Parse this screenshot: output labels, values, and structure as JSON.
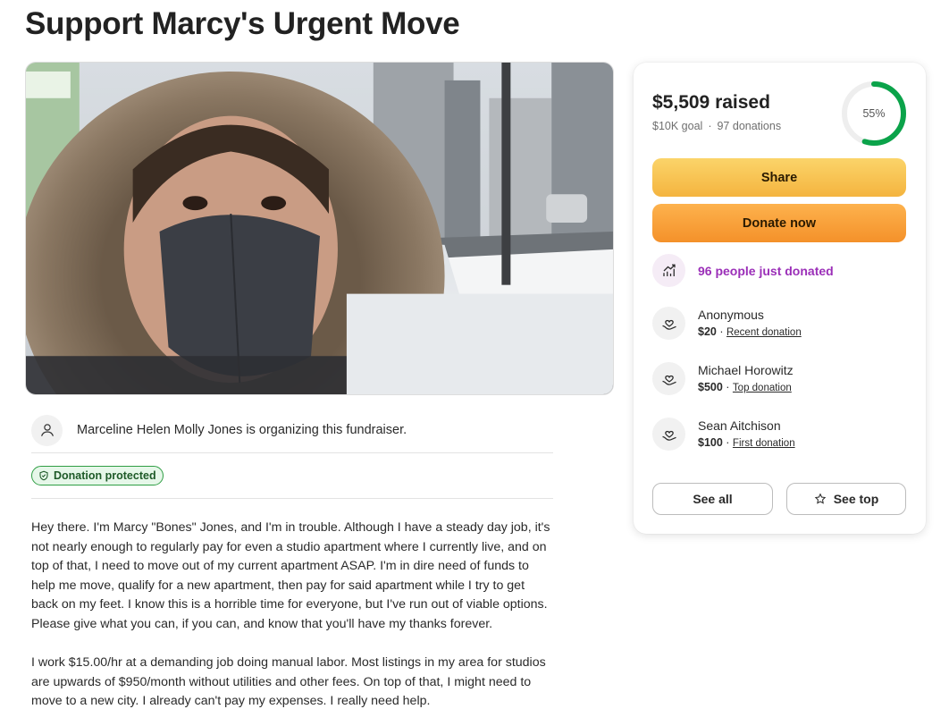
{
  "page": {
    "title": "Support Marcy's Urgent Move"
  },
  "organizer": {
    "text": "Marceline Helen Molly Jones is organizing this fundraiser.",
    "icon": "person-icon"
  },
  "badge": {
    "label": "Donation protected",
    "icon": "shield-check-icon",
    "color": "#2f9e44"
  },
  "story": {
    "paragraphs": [
      "Hey there. I'm Marcy \"Bones\" Jones, and I'm in trouble. Although I have a steady day job, it's not nearly enough to regularly pay for even a studio apartment where I currently live, and on top of that, I need to move out of my current apartment ASAP. I'm in dire need of funds to help me move, qualify for a new apartment, then pay for said apartment while I try to get back on my feet. I know this is a horrible time for everyone, but I've run out of viable options. Please give what you can, if you can, and know that you'll have my thanks forever.",
      "I work $15.00/hr at a demanding job doing manual labor. Most listings in my area for studios are upwards of $950/month without utilities and other fees. On top of that, I might need to move to a new city. I already can't pay my expenses. I really need help."
    ]
  },
  "summary": {
    "raised": "$5,509 raised",
    "goal": "$10K goal",
    "separator": "·",
    "donations": "97 donations",
    "progress_label": "55%",
    "progress_fraction": 0.55,
    "progress_color": "#0ba34a"
  },
  "actions": {
    "share_label": "Share",
    "donate_label": "Donate now"
  },
  "trend": {
    "text": "96 people just donated",
    "icon": "trending-up-icon",
    "color": "#9b2fb8"
  },
  "donors": [
    {
      "name": "Anonymous",
      "amount": "$20",
      "sep": " · ",
      "tag": "Recent donation",
      "icon": "heart-hand-icon"
    },
    {
      "name": "Michael Horowitz",
      "amount": "$500",
      "sep": " · ",
      "tag": "Top donation",
      "icon": "heart-hand-icon"
    },
    {
      "name": "Sean Aitchison",
      "amount": "$100",
      "sep": " · ",
      "tag": "First donation",
      "icon": "heart-hand-icon"
    }
  ],
  "footer_buttons": {
    "see_all": "See all",
    "see_top": "See top",
    "see_top_icon": "star-icon"
  }
}
